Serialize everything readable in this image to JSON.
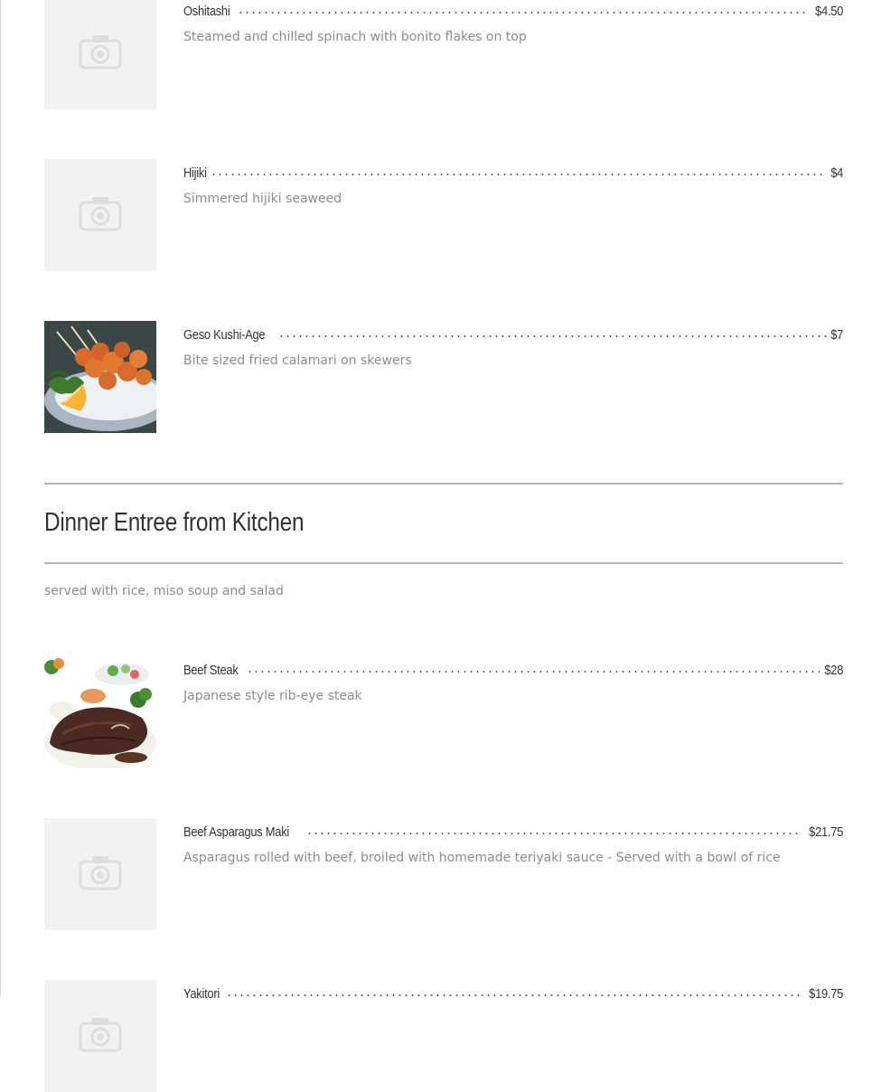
{
  "items_top": [
    {
      "name": "Oshitashi",
      "price": "$4.50",
      "description": "Steamed and chilled spinach with bonito flakes on top",
      "image": "camera-placeholder-icon"
    },
    {
      "name": "Hijiki",
      "price": "$4",
      "description": "Simmered hijiki seaweed",
      "image": "camera-placeholder-icon"
    },
    {
      "name": "Geso Kushi-Age",
      "price": "$7",
      "description": "Bite sized fried calamari on skewers",
      "image": "fried-calamari-skewers-photo"
    }
  ],
  "section": {
    "title": "Dinner Entree from Kitchen",
    "note": "served with rice, miso soup and salad"
  },
  "items_dinner": [
    {
      "name": "Beef Steak",
      "price": "$28",
      "description": "Japanese style rib-eye steak",
      "image": "beef-steak-plate-photo"
    },
    {
      "name": "Beef Asparagus Maki",
      "price": "$21.75",
      "description": "Asparagus rolled with beef, broiled with homemade teriyaki sauce - Served with a bowl of rice",
      "image": "camera-placeholder-icon"
    },
    {
      "name": "Yakitori",
      "price": "$19.75",
      "description": "",
      "image": "camera-placeholder-icon"
    }
  ],
  "colors": {
    "text_dark": "#333333",
    "text_muted": "#8c8c8c",
    "rule": "#b3b3b3",
    "placeholder_bg": "#f2f2f2",
    "placeholder_icon": "#dddddd"
  }
}
